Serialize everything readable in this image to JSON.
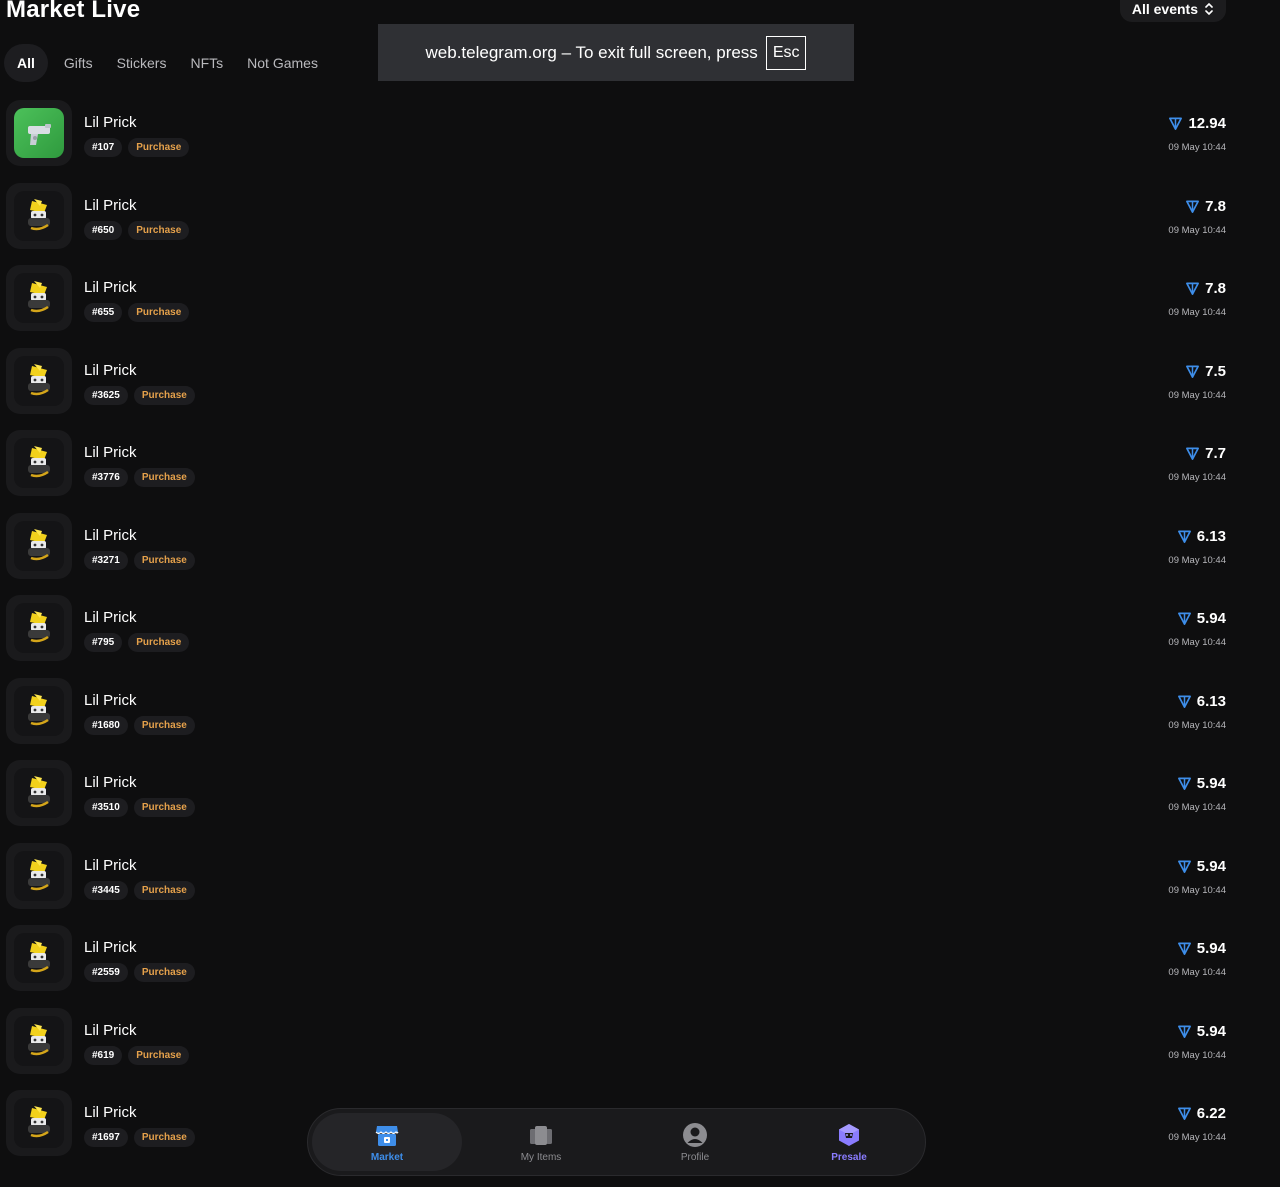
{
  "header": {
    "title": "Market Live",
    "filter_label": "All events"
  },
  "tabs": [
    "All",
    "Gifts",
    "Stickers",
    "NFTs",
    "Not Games"
  ],
  "fullscreen_notice": {
    "text": "web.telegram.org – To exit full screen, press",
    "key": "Esc"
  },
  "colors": {
    "accent_blue": "#3e8eea",
    "purchase_orange": "#e5a14b",
    "presale_purple": "#8a7cff"
  },
  "items": [
    {
      "name": "Lil Prick",
      "id": "#107",
      "action": "Purchase",
      "price": "12.94",
      "time": "09 May 10:44",
      "thumb": "gun-icon"
    },
    {
      "name": "Lil Prick",
      "id": "#650",
      "action": "Purchase",
      "price": "7.8",
      "time": "09 May 10:44",
      "thumb": "character-icon"
    },
    {
      "name": "Lil Prick",
      "id": "#655",
      "action": "Purchase",
      "price": "7.8",
      "time": "09 May 10:44",
      "thumb": "character-icon"
    },
    {
      "name": "Lil Prick",
      "id": "#3625",
      "action": "Purchase",
      "price": "7.5",
      "time": "09 May 10:44",
      "thumb": "character-icon"
    },
    {
      "name": "Lil Prick",
      "id": "#3776",
      "action": "Purchase",
      "price": "7.7",
      "time": "09 May 10:44",
      "thumb": "character-icon"
    },
    {
      "name": "Lil Prick",
      "id": "#3271",
      "action": "Purchase",
      "price": "6.13",
      "time": "09 May 10:44",
      "thumb": "character-icon"
    },
    {
      "name": "Lil Prick",
      "id": "#795",
      "action": "Purchase",
      "price": "5.94",
      "time": "09 May 10:44",
      "thumb": "character-icon"
    },
    {
      "name": "Lil Prick",
      "id": "#1680",
      "action": "Purchase",
      "price": "6.13",
      "time": "09 May 10:44",
      "thumb": "character-icon"
    },
    {
      "name": "Lil Prick",
      "id": "#3510",
      "action": "Purchase",
      "price": "5.94",
      "time": "09 May 10:44",
      "thumb": "character-icon"
    },
    {
      "name": "Lil Prick",
      "id": "#3445",
      "action": "Purchase",
      "price": "5.94",
      "time": "09 May 10:44",
      "thumb": "character-icon"
    },
    {
      "name": "Lil Prick",
      "id": "#2559",
      "action": "Purchase",
      "price": "5.94",
      "time": "09 May 10:44",
      "thumb": "character-icon"
    },
    {
      "name": "Lil Prick",
      "id": "#619",
      "action": "Purchase",
      "price": "5.94",
      "time": "09 May 10:44",
      "thumb": "character-icon"
    },
    {
      "name": "Lil Prick",
      "id": "#1697",
      "action": "Purchase",
      "price": "6.22",
      "time": "09 May 10:44",
      "thumb": "character-icon"
    }
  ],
  "nav": [
    {
      "label": "Market",
      "icon": "store-icon"
    },
    {
      "label": "My Items",
      "icon": "cards-icon"
    },
    {
      "label": "Profile",
      "icon": "profile-icon"
    },
    {
      "label": "Presale",
      "icon": "cube-icon"
    }
  ]
}
